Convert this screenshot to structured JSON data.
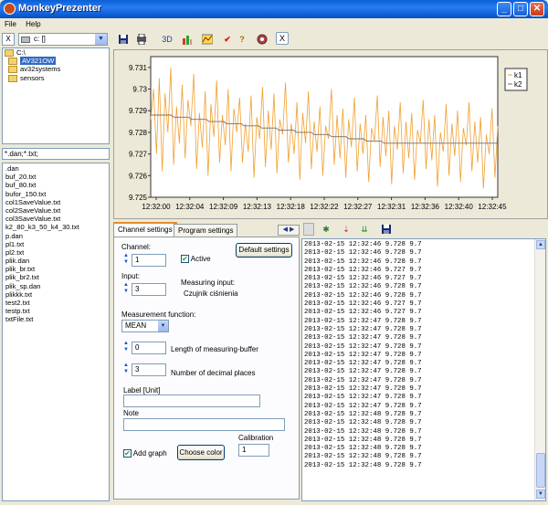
{
  "window": {
    "title": "MonkeyPrezenter"
  },
  "menu": [
    "File",
    "Help"
  ],
  "drive": {
    "close_label": "X",
    "selected": "c: []"
  },
  "folders": {
    "root": "C:\\",
    "items": [
      "AV321OW",
      "av32systems",
      "sensors"
    ],
    "selected_index": 0
  },
  "filter": "*.dan;*.txt;",
  "files": [
    ".dan",
    "buf_20.txt",
    "buf_80.txt",
    "bufor_150.txt",
    "col1SaveValue.txt",
    "col2SaveValue.txt",
    "col3SaveValue.txt",
    "k2_80_k3_50_k4_30.txt",
    "p.dan",
    "pl1.txt",
    "pl2.txt",
    "plik.dan",
    "plik_br.txt",
    "plik_br2.txt",
    "plik_sp.dan",
    "plikkk.txt",
    "test2.txt",
    "testp.txt",
    "txtFile.txt"
  ],
  "toolbar": {
    "label_3d": "3D",
    "close_label": "X"
  },
  "chart_data": {
    "type": "line",
    "x_ticks": [
      "12:32:00",
      "12:32:04",
      "12:32:09",
      "12:32:13",
      "12:32:18",
      "12:32:22",
      "12:32:27",
      "12:32:31",
      "12:32:36",
      "12:32:40",
      "12:32:45"
    ],
    "y_ticks": [
      "9.731",
      "9.73",
      "9.729",
      "9.728",
      "9.727",
      "9.726",
      "9.725"
    ],
    "ylim": [
      9.725,
      9.7315
    ],
    "legend": [
      "k1",
      "k2"
    ],
    "series": [
      {
        "name": "k1",
        "color": "#f0a030",
        "values": [
          9.7286,
          9.73,
          9.727,
          9.7305,
          9.7262,
          9.7298,
          9.728,
          9.731,
          9.7265,
          9.7292,
          9.7275,
          9.7302,
          9.7268,
          9.7295,
          9.7283,
          9.7307,
          9.7263,
          9.7289,
          9.7273,
          9.7299,
          9.726,
          9.7293,
          9.7278,
          9.7304,
          9.7266,
          9.7288,
          9.7274,
          9.73,
          9.7262,
          9.7291,
          9.728,
          9.7296,
          9.7266,
          9.7284,
          9.7271,
          9.7297,
          9.7259,
          9.7287,
          9.7277,
          9.7301,
          9.7264,
          9.729,
          9.7272,
          9.7298,
          9.7261,
          9.7286,
          9.7279,
          9.7303,
          9.7266,
          9.7284,
          9.727,
          9.7294,
          9.7258,
          9.7289,
          9.7275,
          9.7299,
          9.7263,
          9.7285,
          9.7271,
          9.7292,
          9.726,
          9.7283,
          9.7277,
          9.73,
          9.7265,
          9.7288,
          9.7268,
          9.7291,
          9.7259,
          9.7286,
          9.7273,
          9.7296,
          9.7262,
          9.7284,
          9.727,
          9.7288,
          9.7257,
          9.7282,
          9.7276,
          9.7297,
          9.7264,
          9.7287,
          9.7269,
          9.729,
          9.7256,
          9.7283,
          9.7272,
          9.7294,
          9.7261,
          9.7285,
          9.7268,
          9.7289,
          9.7258,
          9.7281,
          9.7275,
          9.7295,
          9.7263,
          9.7286,
          9.7267,
          9.7288,
          9.7255,
          9.728,
          9.7271,
          9.7293,
          9.726,
          9.7284,
          9.7269,
          9.729,
          9.7257,
          9.7282,
          9.7274,
          9.7294,
          9.7262,
          9.7285,
          9.7266,
          9.7287,
          9.7254,
          9.7279,
          9.727,
          9.7291,
          9.7259,
          9.7283
        ]
      },
      {
        "name": "k2",
        "color": "#707070",
        "values": [
          9.7288,
          9.7288,
          9.7288,
          9.7288,
          9.7288,
          9.7288,
          9.7288,
          9.7288,
          9.7287,
          9.7287,
          9.7287,
          9.7287,
          9.7287,
          9.7287,
          9.7286,
          9.7286,
          9.7286,
          9.7286,
          9.7286,
          9.7286,
          9.7285,
          9.7285,
          9.7285,
          9.7285,
          9.7285,
          9.7285,
          9.7284,
          9.7284,
          9.7284,
          9.7284,
          9.7284,
          9.7284,
          9.7283,
          9.7283,
          9.7283,
          9.7283,
          9.7283,
          9.7283,
          9.7282,
          9.7282,
          9.7282,
          9.7282,
          9.7282,
          9.7282,
          9.7281,
          9.7281,
          9.7281,
          9.7281,
          9.7281,
          9.7281,
          9.728,
          9.728,
          9.728,
          9.728,
          9.728,
          9.728,
          9.7279,
          9.7279,
          9.7279,
          9.7279,
          9.7279,
          9.7279,
          9.7278,
          9.7278,
          9.7278,
          9.7278,
          9.7278,
          9.7278,
          9.7277,
          9.7277,
          9.7277,
          9.7277,
          9.7277,
          9.7277,
          9.7276,
          9.7276,
          9.7276,
          9.7276,
          9.7276,
          9.7276,
          9.7275,
          9.7275,
          9.7275,
          9.7275,
          9.7275,
          9.7275,
          9.7275,
          9.7275,
          9.7275,
          9.7275,
          9.7275,
          9.7275,
          9.7275,
          9.7275,
          9.7275,
          9.7275,
          9.7275,
          9.7275,
          9.7275,
          9.7275,
          9.7275,
          9.7275,
          9.7275,
          9.7275,
          9.7275,
          9.7275,
          9.7275,
          9.7275,
          9.7275,
          9.7275,
          9.7275,
          9.7275,
          9.7275,
          9.7275,
          9.7275,
          9.7275,
          9.7275,
          9.7275,
          9.7275,
          9.7275
        ]
      }
    ]
  },
  "tabs": {
    "channel": "Channel settings",
    "program": "Program settings"
  },
  "settings": {
    "channel_label": "Channel:",
    "channel_value": "1",
    "active_label": "Active",
    "default_button": "Default settings",
    "input_label": "Input:",
    "input_value": "3",
    "measuring_input_label": "Measuring input:",
    "measuring_input_value": "Czujnik ciśnienia",
    "function_label": "Measurement function:",
    "function_value": "MEAN",
    "buffer_value": "0",
    "buffer_label": "Length of measuring-buffer",
    "decimals_value": "3",
    "decimals_label": "Number of decimal places",
    "label_unit_label": "Label [Unit]",
    "label_unit_value": "",
    "note_label": "Note",
    "note_value": "",
    "calibration_label": "Calibration",
    "calibration_value": "1",
    "add_graph_label": "Add graph",
    "choose_color_button": "Choose color"
  },
  "log_lines": [
    "2013-02-15 12:32:46 9.728 9.7",
    "2013-02-15 12:32:46 9.728 9.7",
    "2013-02-15 12:32:46 9.728 9.7",
    "2013-02-15 12:32:46 9.727 9.7",
    "2013-02-15 12:32:46 9.727 9.7",
    "2013-02-15 12:32:46 9.728 9.7",
    "2013-02-15 12:32:46 9.728 9.7",
    "2013-02-15 12:32:46 9.727 9.7",
    "2013-02-15 12:32:46 9.727 9.7",
    "2013-02-15 12:32:47 9.728 9.7",
    "2013-02-15 12:32:47 9.728 9.7",
    "2013-02-15 12:32:47 9.728 9.7",
    "2013-02-15 12:32:47 9.728 9.7",
    "2013-02-15 12:32:47 9.728 9.7",
    "2013-02-15 12:32:47 9.728 9.7",
    "2013-02-15 12:32:47 9.728 9.7",
    "2013-02-15 12:32:47 9.728 9.7",
    "2013-02-15 12:32:47 9.728 9.7",
    "2013-02-15 12:32:47 9.728 9.7",
    "2013-02-15 12:32:47 9.728 9.7",
    "2013-02-15 12:32:48 9.728 9.7",
    "2013-02-15 12:32:48 9.728 9.7",
    "2013-02-15 12:32:48 9.728 9.7",
    "2013-02-15 12:32:48 9.728 9.7",
    "2013-02-15 12:32:48 9.728 9.7",
    "2013-02-15 12:32:48 9.728 9.7",
    "2013-02-15 12:32:48 9.728 9.7"
  ]
}
